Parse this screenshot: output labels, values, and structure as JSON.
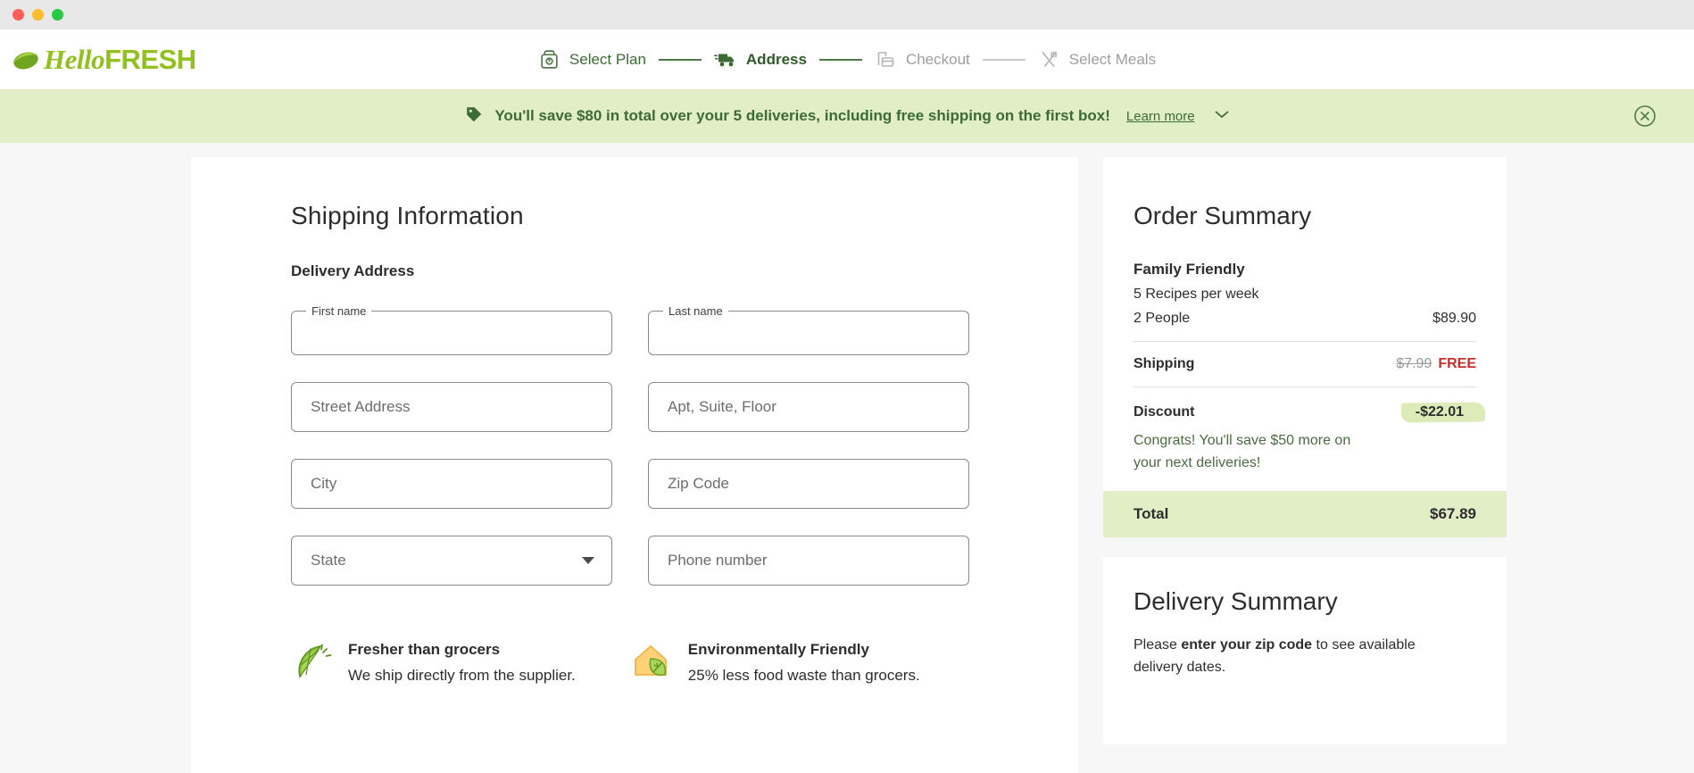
{
  "window": {
    "traffic_lights": [
      "close",
      "minimize",
      "maximize"
    ]
  },
  "header": {
    "logo_hello": "Hello",
    "logo_fresh": "FRESH",
    "brand_color": "#91c11e",
    "stepper": [
      {
        "label": "Select Plan",
        "icon": "meal-kit-box-icon",
        "state": "done"
      },
      {
        "label": "Address",
        "icon": "delivery-truck-icon",
        "state": "active"
      },
      {
        "label": "Checkout",
        "icon": "credit-card-icon",
        "state": "upcoming"
      },
      {
        "label": "Select Meals",
        "icon": "fork-knife-icon",
        "state": "upcoming"
      }
    ]
  },
  "banner": {
    "icon": "price-tag-icon",
    "text": "You'll save $80 in total over your 5 deliveries, including free shipping on the first box!",
    "link": "Learn more",
    "chevron": "chevron-down-icon",
    "close": "close-circle-icon",
    "bg_color": "#e2eec6",
    "text_color": "#3d6b35"
  },
  "form": {
    "title": "Shipping Information",
    "section_label": "Delivery Address",
    "fields": [
      {
        "name": "first-name",
        "label": "First name",
        "value": "",
        "type": "floating"
      },
      {
        "name": "last-name",
        "label": "Last name",
        "value": "",
        "type": "floating"
      },
      {
        "name": "street-address",
        "placeholder": "Street Address",
        "value": "",
        "type": "text"
      },
      {
        "name": "apt-suite",
        "placeholder": "Apt, Suite, Floor",
        "value": "",
        "type": "text"
      },
      {
        "name": "city",
        "placeholder": "City",
        "value": "",
        "type": "text"
      },
      {
        "name": "zip-code",
        "placeholder": "Zip Code",
        "value": "",
        "type": "text"
      },
      {
        "name": "state",
        "placeholder": "State",
        "value": "",
        "type": "select"
      },
      {
        "name": "phone-number",
        "placeholder": "Phone number",
        "value": "",
        "type": "text"
      }
    ],
    "features": [
      {
        "icon": "lime-slice-icon",
        "title": "Fresher than grocers",
        "desc": "We ship directly from the supplier."
      },
      {
        "icon": "house-leaf-icon",
        "title": "Environmentally Friendly",
        "desc": "25% less food waste than grocers."
      }
    ]
  },
  "order_summary": {
    "title": "Order Summary",
    "plan_name": "Family Friendly",
    "recipes_line": "5 Recipes per week",
    "people_line": "2 People",
    "plan_price": "$89.90",
    "shipping_label": "Shipping",
    "shipping_original": "$7.99",
    "shipping_value": "FREE",
    "shipping_free_color": "#c4312e",
    "discount_label": "Discount",
    "discount_value": "-$22.01",
    "discount_highlight_color": "#dcebb8",
    "congrats": "Congrats! You'll save $50 more on your next deliveries!",
    "total_label": "Total",
    "total_value": "$67.89"
  },
  "delivery_summary": {
    "title": "Delivery Summary",
    "note_prefix": "Please ",
    "note_bold": "enter your zip code",
    "note_suffix": " to see available delivery dates."
  }
}
